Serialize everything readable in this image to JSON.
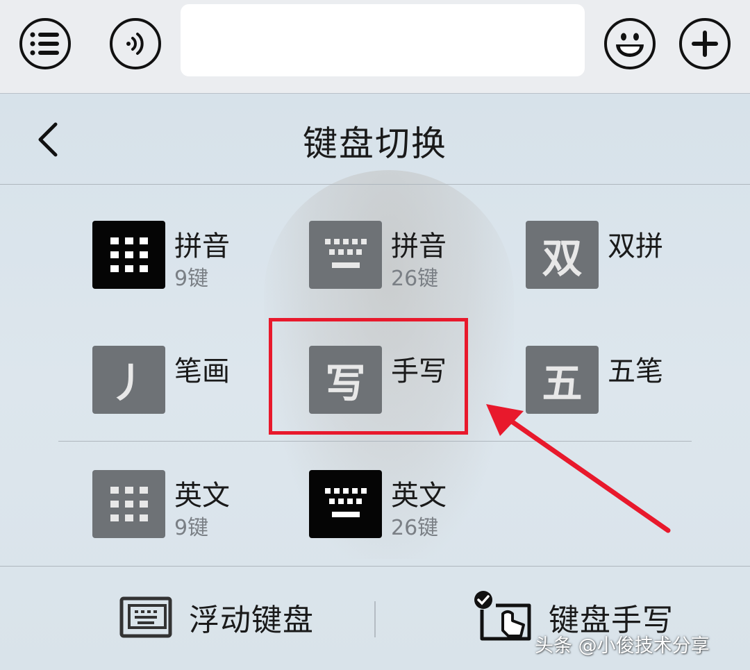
{
  "panel": {
    "title": "键盘切换"
  },
  "keyboards": [
    {
      "id": "pinyin9",
      "label": "拼音",
      "sub": "9键",
      "icon": "grid-3x3-icon",
      "active": true
    },
    {
      "id": "pinyin26",
      "label": "拼音",
      "sub": "26键",
      "icon": "qwerty-keyboard-icon",
      "active": false
    },
    {
      "id": "shuangpin",
      "label": "双拼",
      "sub": "",
      "icon_glyph": "双",
      "active": false
    },
    {
      "id": "bihua",
      "label": "笔画",
      "sub": "",
      "icon_glyph": "丿",
      "active": false
    },
    {
      "id": "handwriting",
      "label": "手写",
      "sub": "",
      "icon_glyph": "写",
      "active": false
    },
    {
      "id": "wubi",
      "label": "五笔",
      "sub": "",
      "icon_glyph": "五",
      "active": false
    },
    {
      "id": "english9",
      "label": "英文",
      "sub": "9键",
      "icon": "grid-3x3-icon",
      "active": false
    },
    {
      "id": "english26",
      "label": "英文",
      "sub": "26键",
      "icon": "qwerty-keyboard-icon",
      "active": true
    }
  ],
  "footer": {
    "floating_label": "浮动键盘",
    "handwriting_label": "键盘手写"
  },
  "watermark": "头条 @小俊技术分享",
  "colors": {
    "highlight": "#e8192c",
    "icon_active": "#050505",
    "icon_inactive": "#6e7276"
  }
}
